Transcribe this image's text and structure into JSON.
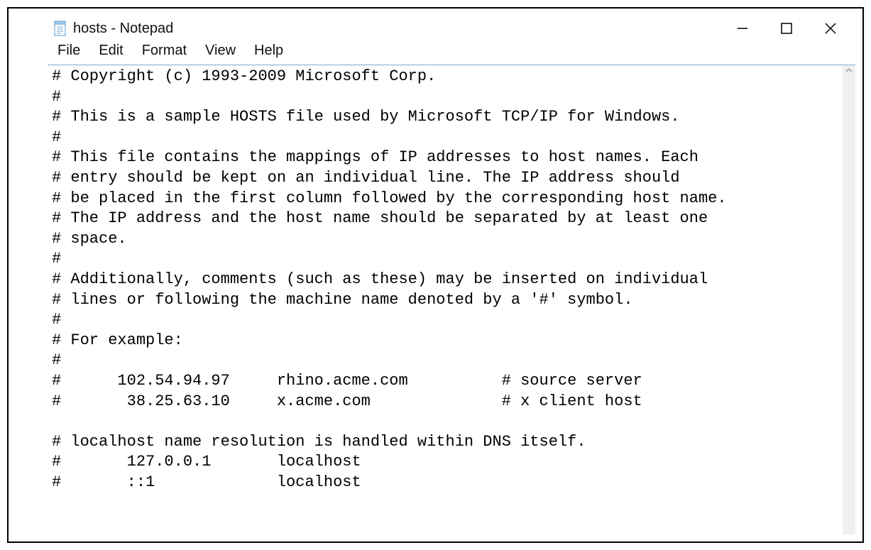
{
  "window": {
    "title": "hosts - Notepad"
  },
  "menu": {
    "file": "File",
    "edit": "Edit",
    "format": "Format",
    "view": "View",
    "help": "Help"
  },
  "content": "# Copyright (c) 1993-2009 Microsoft Corp.\n#\n# This is a sample HOSTS file used by Microsoft TCP/IP for Windows.\n#\n# This file contains the mappings of IP addresses to host names. Each\n# entry should be kept on an individual line. The IP address should\n# be placed in the first column followed by the corresponding host name.\n# The IP address and the host name should be separated by at least one\n# space.\n#\n# Additionally, comments (such as these) may be inserted on individual\n# lines or following the machine name denoted by a '#' symbol.\n#\n# For example:\n#\n#      102.54.94.97     rhino.acme.com          # source server\n#       38.25.63.10     x.acme.com              # x client host\n\n# localhost name resolution is handled within DNS itself.\n#       127.0.0.1       localhost\n#       ::1             localhost"
}
